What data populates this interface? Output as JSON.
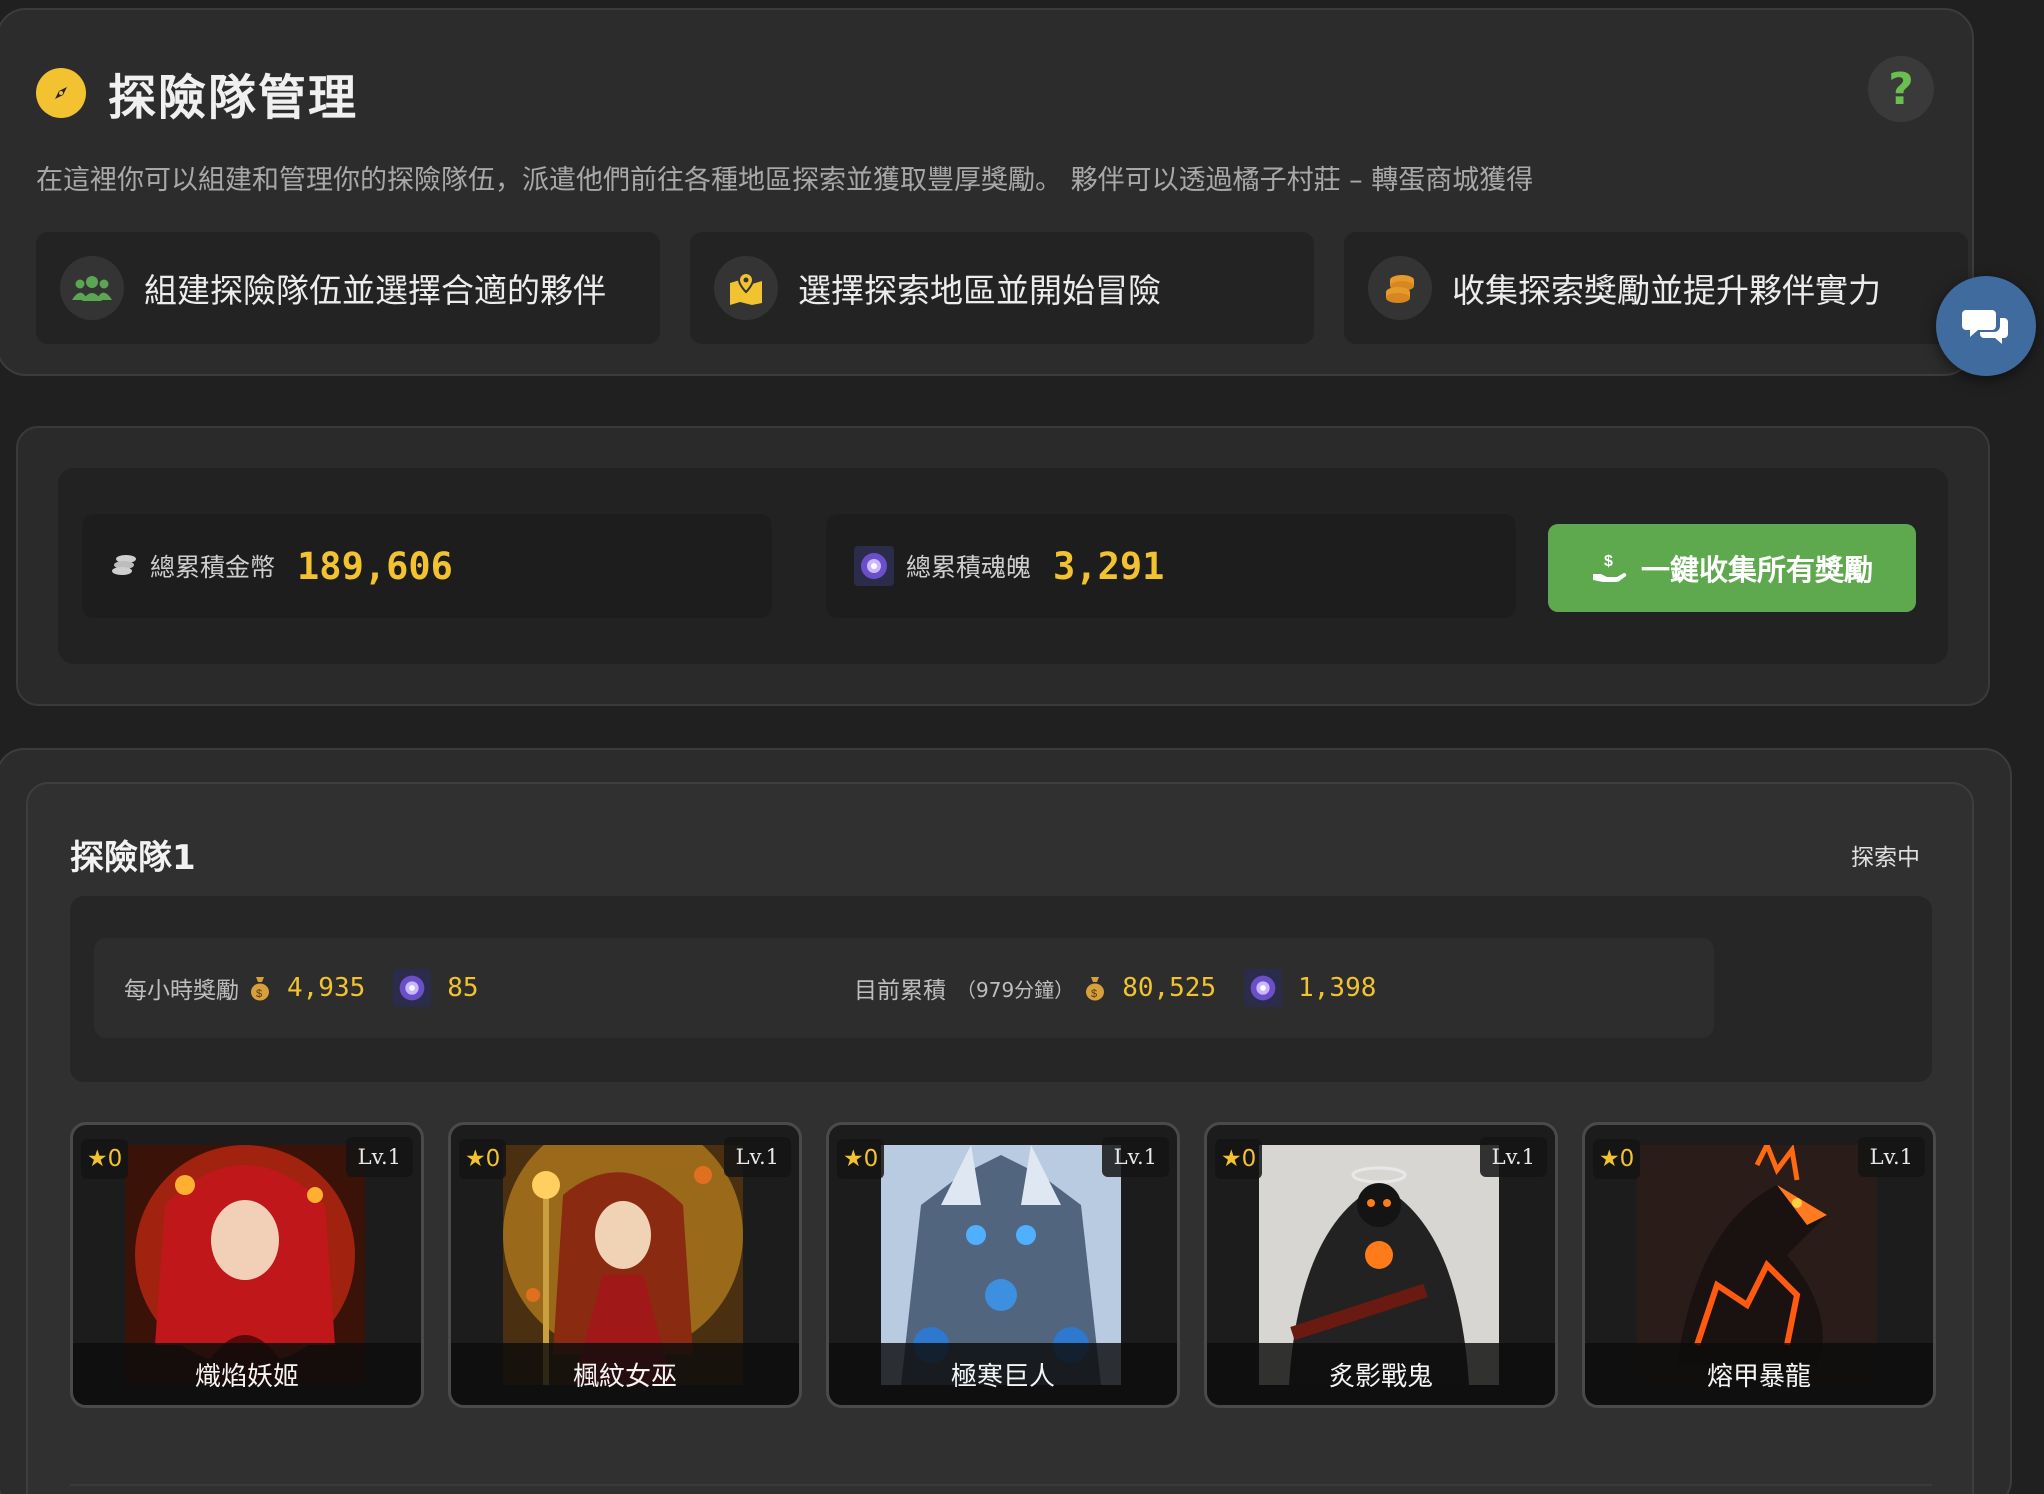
{
  "intro": {
    "title": "探險隊管理",
    "help_label": "?",
    "description": "在這裡你可以組建和管理你的探險隊伍，派遣他們前往各種地區探索並獲取豐厚獎勵。 夥伴可以透過橘子村莊 – 轉蛋商城獲得",
    "features": [
      {
        "label": "組建探險隊伍並選擇合適的夥伴",
        "icon": "users-icon",
        "color": "#5aa653"
      },
      {
        "label": "選擇探索地區並開始冒險",
        "icon": "map-marker-icon",
        "color": "#f2c230"
      },
      {
        "label": "收集探索獎勵並提升夥伴實力",
        "icon": "coins-icon",
        "color": "#e69a2e"
      }
    ]
  },
  "totals": {
    "gold_label": "總累積金幣",
    "gold_value": "189,606",
    "soul_label": "總累積魂魄",
    "soul_value": "3,291",
    "collect_button": "一鍵收集所有獎勵"
  },
  "team": {
    "title": "探險隊1",
    "status": "探索中",
    "hourly_label": "每小時獎勵",
    "hourly_gold": "4,935",
    "hourly_soul": "85",
    "current_label": "目前累積",
    "current_minutes": "（979分鐘）",
    "current_gold": "80,525",
    "current_soul": "1,398",
    "companions": [
      {
        "name": "熾焰妖姬",
        "stars": "★0",
        "level": "Lv.1"
      },
      {
        "name": "楓紋女巫",
        "stars": "★0",
        "level": "Lv.1"
      },
      {
        "name": "極寒巨人",
        "stars": "★0",
        "level": "Lv.1"
      },
      {
        "name": "炙影戰鬼",
        "stars": "★0",
        "level": "Lv.1"
      },
      {
        "name": "熔甲暴龍",
        "stars": "★0",
        "level": "Lv.1"
      }
    ]
  },
  "colors": {
    "accent_gold": "#f2c230",
    "collect_green": "#5ea84e",
    "chat_blue": "#3f6b9e"
  }
}
